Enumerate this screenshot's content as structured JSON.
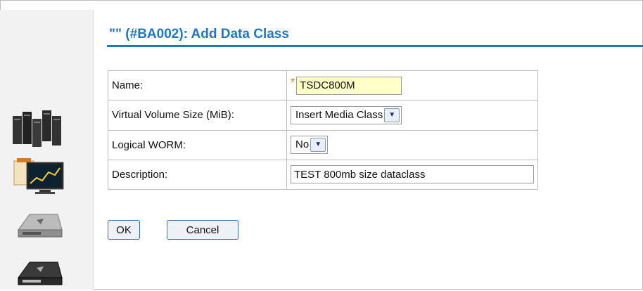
{
  "header": {
    "title": "\"\" (#BA002): Add Data Class"
  },
  "form": {
    "name": {
      "label": "Name:",
      "required_marker": "*",
      "value": "TSDC800M"
    },
    "volume_size": {
      "label": "Virtual Volume Size (MiB):",
      "selected": "Insert Media Class"
    },
    "logical_worm": {
      "label": "Logical WORM:",
      "selected": "No"
    },
    "description": {
      "label": "Description:",
      "value": "TEST 800mb size dataclass"
    }
  },
  "actions": {
    "ok_label": "OK",
    "cancel_label": "Cancel"
  },
  "sidebar": {
    "icons": [
      "server-cluster-icon",
      "monitor-chart-icon",
      "tape-drive-icon",
      "tape-drive-dark-icon"
    ]
  },
  "colors": {
    "title": "#1f77c6",
    "name_field_bg": "#ffffc8",
    "button_border": "#3c6fb0"
  }
}
